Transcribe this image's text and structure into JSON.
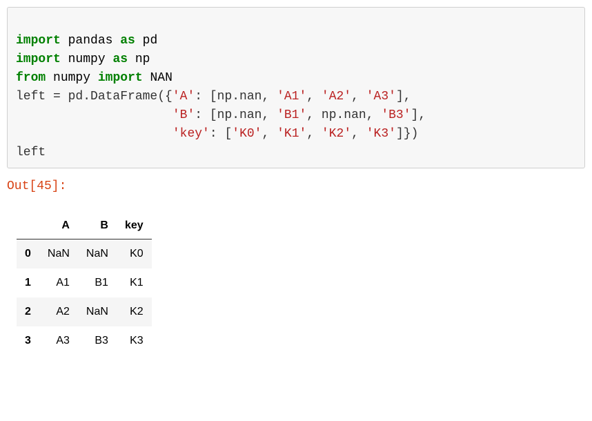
{
  "code": {
    "line1": {
      "kw_import": "import",
      "m1": "pandas",
      "kw_as": "as",
      "a1": "pd"
    },
    "line2": {
      "kw_import": "import",
      "m2": "numpy",
      "kw_as": "as",
      "a2": "np"
    },
    "line3": {
      "kw_from": "from",
      "m": "numpy",
      "kw_import": "import",
      "name": "NAN"
    },
    "line4": {
      "assign": "left = pd.DataFrame({",
      "kA": "'A'",
      "np_nan": "np.nan",
      "sA1": "'A1'",
      "sA2": "'A2'",
      "sA3": "'A3'"
    },
    "line5": {
      "kB": "'B'",
      "np_nan1": "np.nan",
      "sB1": "'B1'",
      "np_nan2": "np.nan",
      "sB3": "'B3'"
    },
    "line6": {
      "kKey": "'key'",
      "sK0": "'K0'",
      "sK1": "'K1'",
      "sK2": "'K2'",
      "sK3": "'K3'"
    },
    "line7": {
      "expr": "left"
    }
  },
  "out_label": "Out[45]:",
  "table": {
    "cols": {
      "A": "A",
      "B": "B",
      "key": "key"
    },
    "rows": [
      {
        "idx": "0",
        "A": "NaN",
        "B": "NaN",
        "key": "K0"
      },
      {
        "idx": "1",
        "A": "A1",
        "B": "B1",
        "key": "K1"
      },
      {
        "idx": "2",
        "A": "A2",
        "B": "NaN",
        "key": "K2"
      },
      {
        "idx": "3",
        "A": "A3",
        "B": "B3",
        "key": "K3"
      }
    ]
  }
}
